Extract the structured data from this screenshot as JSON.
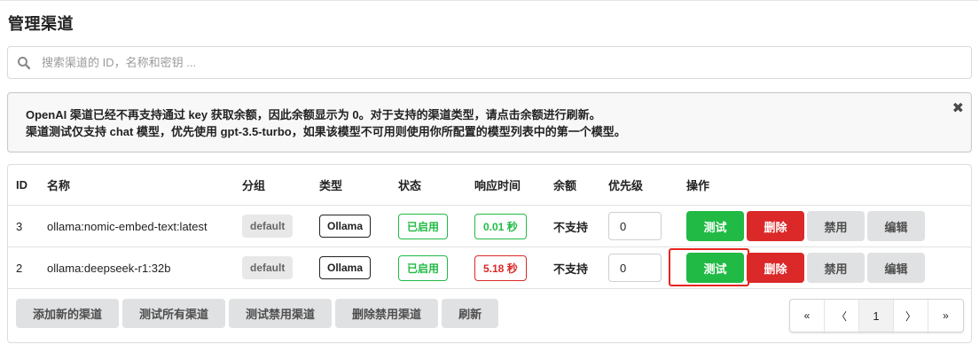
{
  "page": {
    "title": "管理渠道"
  },
  "search": {
    "placeholder": "搜索渠道的 ID，名称和密钥 ...",
    "value": ""
  },
  "notice": {
    "line1": "OpenAI 渠道已经不再支持通过 key 获取余额，因此余额显示为 0。对于支持的渠道类型，请点击余额进行刷新。",
    "line2": "渠道测试仅支持 chat 模型，优先使用 gpt-3.5-turbo，如果该模型不可用则使用你所配置的模型列表中的第一个模型。",
    "close_symbol": "✖"
  },
  "table": {
    "headers": {
      "id": "ID",
      "name": "名称",
      "group": "分组",
      "type": "类型",
      "status": "状态",
      "response_time": "响应时间",
      "balance": "余额",
      "priority": "优先级",
      "actions": "操作"
    },
    "rows": [
      {
        "id": "3",
        "name": "ollama:nomic-embed-text:latest",
        "group": "default",
        "type": "Ollama",
        "status": "已启用",
        "response_time": "0.01 秒",
        "response_color": "#21ba45",
        "balance": "不支持",
        "priority": "0"
      },
      {
        "id": "2",
        "name": "ollama:deepseek-r1:32b",
        "group": "default",
        "type": "Ollama",
        "status": "已启用",
        "response_time": "5.18 秒",
        "response_color": "#db2828",
        "balance": "不支持",
        "priority": "0"
      }
    ],
    "actions": {
      "test": "测试",
      "delete": "删除",
      "disable": "禁用",
      "edit": "编辑"
    }
  },
  "footer": {
    "add_channel": "添加新的渠道",
    "test_all": "测试所有渠道",
    "test_disabled": "测试禁用渠道",
    "delete_disabled": "删除禁用渠道",
    "refresh": "刷新"
  },
  "pagination": {
    "first": "«",
    "prev": "〈",
    "current": "1",
    "next": "〉",
    "last": "»"
  },
  "colors": {
    "green": "#21ba45",
    "red": "#db2828",
    "grey_button": "#e0e1e2",
    "highlight": "#e8251e"
  },
  "icons": {
    "search": "search-icon",
    "close": "close-icon"
  }
}
